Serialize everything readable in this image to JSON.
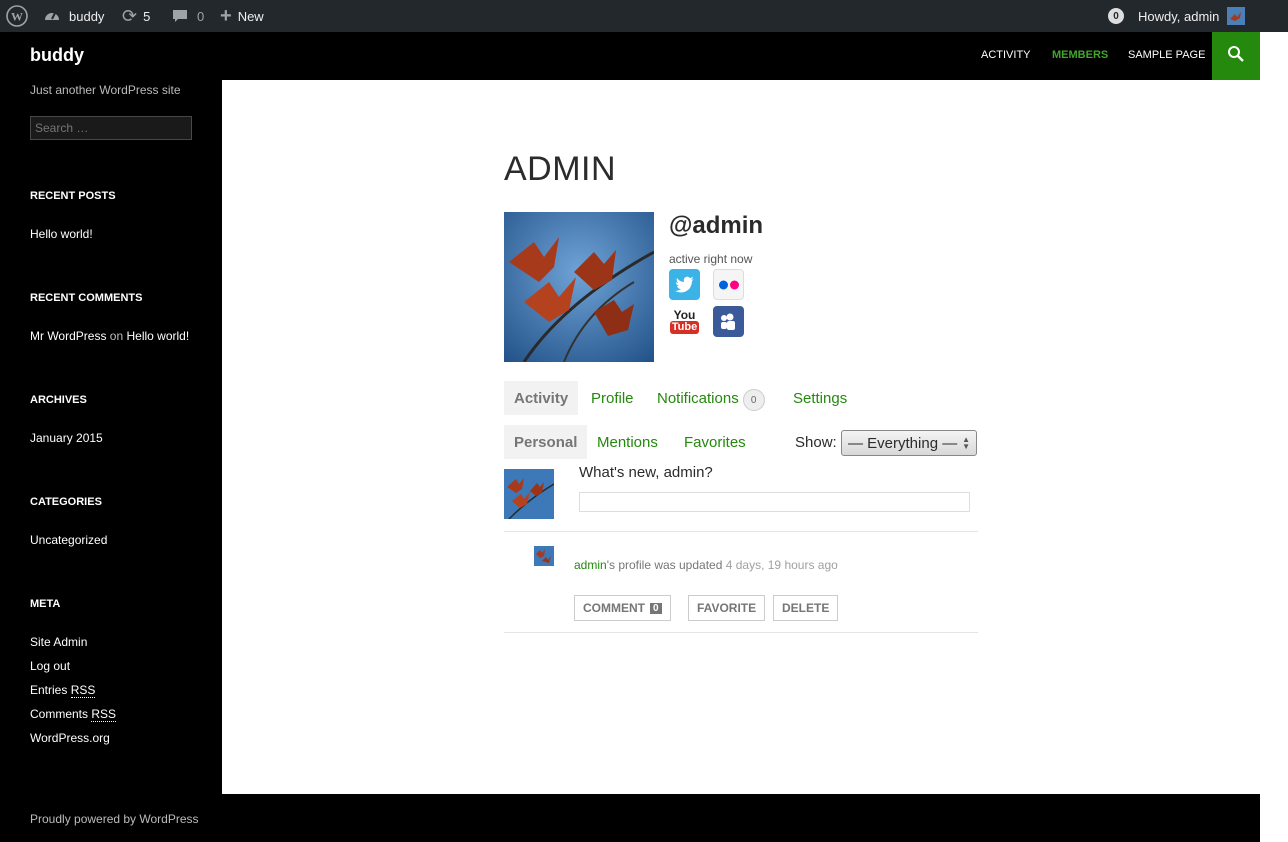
{
  "adminbar": {
    "site_name": "buddy",
    "updates_count": "5",
    "comments_count": "0",
    "new_label": "New",
    "notifications_count": "0",
    "howdy": "Howdy, admin"
  },
  "header": {
    "site_title": "buddy",
    "nav": [
      "ACTIVITY",
      "MEMBERS",
      "SAMPLE PAGE"
    ],
    "current_nav": "MEMBERS"
  },
  "sidebar": {
    "tagline": "Just another WordPress site",
    "search_placeholder": "Search …",
    "recent_posts_title": "RECENT POSTS",
    "recent_posts": [
      "Hello world!"
    ],
    "recent_comments_title": "RECENT COMMENTS",
    "recent_comment": {
      "author": "Mr WordPress",
      "on": "on",
      "post": "Hello world!"
    },
    "archives_title": "ARCHIVES",
    "archives": [
      "January 2015"
    ],
    "categories_title": "CATEGORIES",
    "categories": [
      "Uncategorized"
    ],
    "meta_title": "META",
    "meta": {
      "site_admin": "Site Admin",
      "log_out": "Log out",
      "entries": "Entries",
      "comments": "Comments",
      "rss": "RSS",
      "wordpress_org": "WordPress.org"
    }
  },
  "profile": {
    "title": "ADMIN",
    "username": "@admin",
    "status": "active right now",
    "social": [
      "twitter-icon",
      "flickr-icon",
      "youtube-icon",
      "myspace-icon"
    ],
    "tabs": [
      {
        "label": "Activity"
      },
      {
        "label": "Profile"
      },
      {
        "label": "Notifications",
        "count": "0"
      },
      {
        "label": "Settings"
      }
    ],
    "subtabs": [
      "Personal",
      "Mentions",
      "Favorites"
    ],
    "show_label": "Show:",
    "show_value": "— Everything —",
    "whats_new": "What's new, admin?",
    "activity": {
      "user": "admin",
      "text": "'s profile was updated",
      "time": "4 days, 19 hours ago",
      "comment_label": "COMMENT",
      "comment_count": "0",
      "favorite_label": "FAVORITE",
      "delete_label": "DELETE"
    }
  },
  "footer": {
    "text": "Proudly powered by WordPress"
  },
  "colors": {
    "accent": "#24890d",
    "accent_light": "#41a62a",
    "adminbar": "#23282d"
  }
}
